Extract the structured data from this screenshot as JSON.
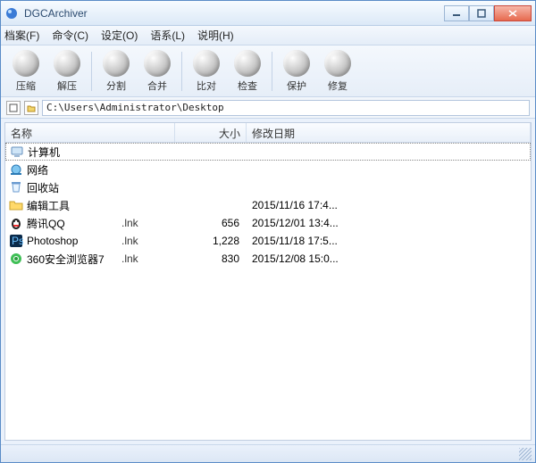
{
  "app": {
    "title": "DGCArchiver"
  },
  "menu": {
    "file": "档案(F)",
    "command": "命令(C)",
    "options": "设定(O)",
    "language": "语系(L)",
    "help": "说明(H)"
  },
  "toolbar": {
    "compress": "压缩",
    "extract": "解压",
    "split": "分割",
    "merge": "合并",
    "compare": "比对",
    "inspect": "检查",
    "protect": "保护",
    "repair": "修复"
  },
  "path": {
    "value": "C:\\Users\\Administrator\\Desktop"
  },
  "columns": {
    "name": "名称",
    "size": "大小",
    "date": "修改日期"
  },
  "rows": [
    {
      "icon": "computer",
      "name": "计算机",
      "ext": "",
      "size": "",
      "date": ""
    },
    {
      "icon": "network",
      "name": "网络",
      "ext": "",
      "size": "",
      "date": ""
    },
    {
      "icon": "recycle",
      "name": "回收站",
      "ext": "",
      "size": "",
      "date": ""
    },
    {
      "icon": "folder",
      "name": "编辑工具",
      "ext": "",
      "size": "",
      "date": "2015/11/16 17:4..."
    },
    {
      "icon": "qq",
      "name": "腾讯QQ",
      "ext": ".lnk",
      "size": "656",
      "date": "2015/12/01 13:4..."
    },
    {
      "icon": "ps",
      "name": "Photoshop",
      "ext": ".lnk",
      "size": "1,228",
      "date": "2015/11/18 17:5..."
    },
    {
      "icon": "browser",
      "name": "360安全浏览器7",
      "ext": ".lnk",
      "size": "830",
      "date": "2015/12/08 15:0..."
    }
  ]
}
